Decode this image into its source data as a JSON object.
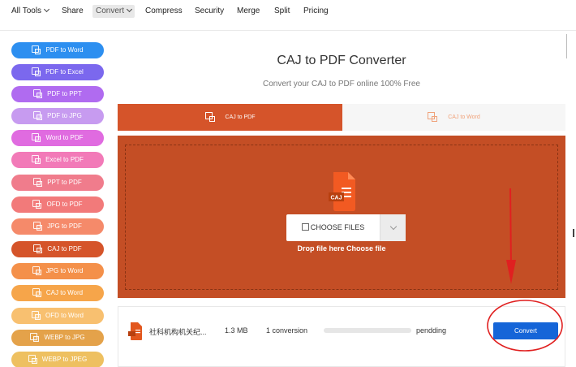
{
  "nav": {
    "items": [
      {
        "label": "All Tools",
        "dropdown": true
      },
      {
        "label": "Share",
        "dropdown": false
      },
      {
        "label": "Convert",
        "dropdown": true,
        "active": true
      },
      {
        "label": "Compress",
        "dropdown": false
      },
      {
        "label": "Security",
        "dropdown": false
      },
      {
        "label": "Merge",
        "dropdown": false
      },
      {
        "label": "Split",
        "dropdown": false
      },
      {
        "label": "Pricing",
        "dropdown": false
      }
    ]
  },
  "sidebar": {
    "items": [
      {
        "label": "PDF to Word",
        "color": "#2d8ff0"
      },
      {
        "label": "PDF to Excel",
        "color": "#7b68ee"
      },
      {
        "label": "PDF to PPT",
        "color": "#b06bf0"
      },
      {
        "label": "PDF to JPG",
        "color": "#c79bf0"
      },
      {
        "label": "Word to PDF",
        "color": "#e06be0"
      },
      {
        "label": "Excel to PDF",
        "color": "#f27ab8"
      },
      {
        "label": "PPT to PDF",
        "color": "#f07c8c"
      },
      {
        "label": "OFD to PDF",
        "color": "#f27a7a"
      },
      {
        "label": "JPG to PDF",
        "color": "#f58a6a"
      },
      {
        "label": "CAJ to PDF",
        "color": "#d5542a"
      },
      {
        "label": "JPG to Word",
        "color": "#f4904a"
      },
      {
        "label": "CAJ to Word",
        "color": "#f6a54a"
      },
      {
        "label": "OFD to Word",
        "color": "#f8c070"
      },
      {
        "label": "WEBP to JPG",
        "color": "#e4a24a"
      },
      {
        "label": "WEBP to JPEG",
        "color": "#eec060"
      }
    ]
  },
  "main": {
    "title": "CAJ to PDF Converter",
    "subtitle": "Convert your CAJ to PDF online 100% Free",
    "tabs": [
      {
        "label": "CAJ to PDF",
        "active": true
      },
      {
        "label": "CAJ to Word",
        "active": false
      }
    ],
    "upload": {
      "file_badge": "CAJ",
      "choose_label": "CHOOSE FILES",
      "drop_text": "Drop file here Choose file"
    },
    "file_row": {
      "name": "社科机构机关纪...",
      "size": "1.3 MB",
      "conversions": "1 conversion",
      "progress": 0,
      "status": "pendding",
      "action": "Convert"
    }
  },
  "colors": {
    "accent": "#d5542a",
    "dropzone": "#c44e25",
    "convert_button": "#1565d8",
    "annotation": "#e02020"
  },
  "icons": {
    "sidebar": "file-convert-icon",
    "file": "caj-file-icon",
    "dropdown": "chevron-down-icon"
  }
}
